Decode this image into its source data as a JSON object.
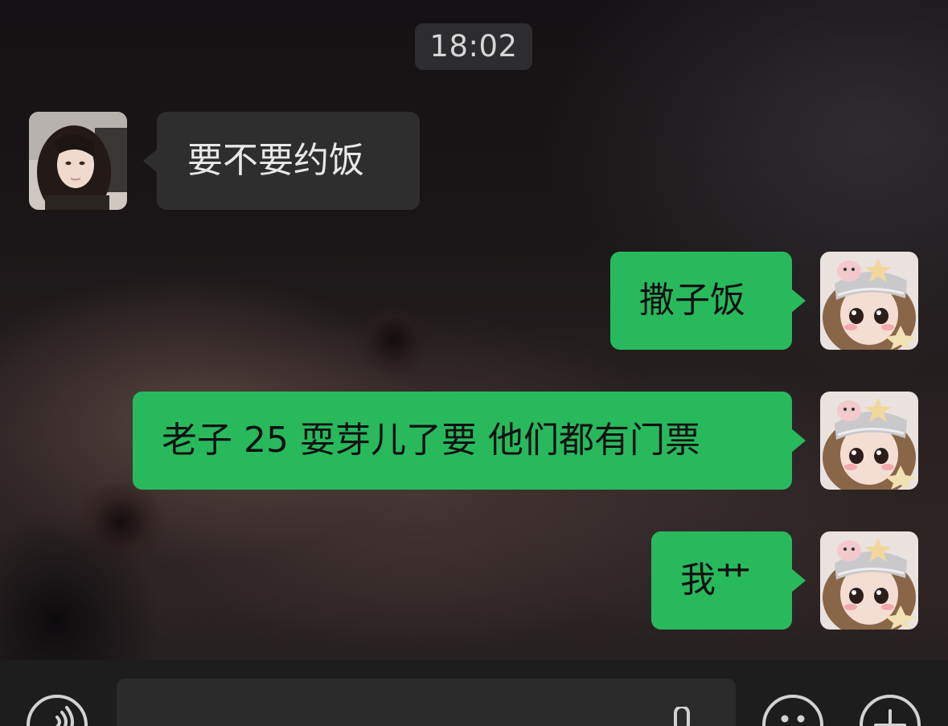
{
  "chat": {
    "timestamp": "18:02",
    "messages": [
      {
        "direction": "incoming",
        "text": "要不要约饭"
      },
      {
        "direction": "outgoing",
        "text": "撒子饭"
      },
      {
        "direction": "outgoing",
        "text": "老子 25 耍芽儿了要 他们都有门票"
      },
      {
        "direction": "outgoing",
        "text": "我艹"
      }
    ]
  },
  "input_bar": {
    "message_value": "",
    "icons": {
      "voice": "voice-toggle-icon",
      "mic": "microphone-icon",
      "emoji": "emoji-icon",
      "more": "plus-icon"
    }
  },
  "colors": {
    "incoming_bubble": "#2e2e2f",
    "outgoing_bubble": "#29b95d",
    "timestamp_pill": "#303032",
    "input_bar": "#1d1d1e"
  }
}
